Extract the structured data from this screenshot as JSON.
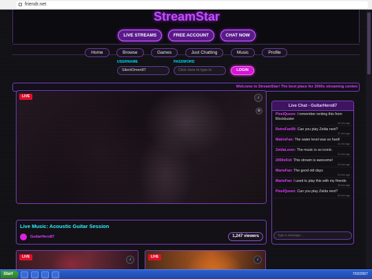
{
  "browser": {
    "url": "friendr.net"
  },
  "site": {
    "logo": "StreamStar",
    "top_buttons": [
      "LIVE STREAMS",
      "FREE ACCOUNT",
      "CHAT NOW"
    ],
    "menu": [
      "Home",
      "Browse",
      "Games",
      "Just Chatting",
      "Music",
      "Profile"
    ]
  },
  "login": {
    "username_label": "USERNAME",
    "username_value": "SilentOmen87",
    "password_label": "PASSWORD",
    "password_placeholder": "Click here to type in",
    "login_button": "LOGIN"
  },
  "ticker": "Welcome to StreamStar! The best place for 2000s streaming conten",
  "player": {
    "badge": "LIVE",
    "mute_icon": "speaker-icon",
    "settings_icon": "gear-icon"
  },
  "stream_info": {
    "title": "Live Music: Acoustic Guitar Session",
    "streamer": "GuitarHero87",
    "viewers": "1,247 viewers"
  },
  "thumbnails": [
    {
      "badge": "LIVE"
    },
    {
      "badge": "LIVE"
    }
  ],
  "chat": {
    "header": "Live Chat - GuitarHero87",
    "messages": [
      {
        "user": "PixelQueen:",
        "text": "I remember renting this from Blockbuster",
        "time": "30 min ago",
        "color": "#e040ff"
      },
      {
        "user": "RetroFan99:",
        "text": "Can you play Zelda next?",
        "time": "27 min ago",
        "color": "#e040ff"
      },
      {
        "user": "MatrixFan:",
        "text": "The water level was so hard!",
        "time": "41 min ago",
        "color": "#e040ff"
      },
      {
        "user": "ZeldaLover:",
        "text": "The music is so iconic.",
        "time": "31 min ago",
        "color": "#e040ff"
      },
      {
        "user": "2000sKid:",
        "text": "This stream is awesome!",
        "time": "24 min ago",
        "color": "#e040ff"
      },
      {
        "user": "MarioFan:",
        "text": "The good old days",
        "time": "23 min ago",
        "color": "#e040ff"
      },
      {
        "user": "MarioFan:",
        "text": "I used to play this with my friends",
        "time": "45 min ago",
        "color": "#e040ff"
      },
      {
        "user": "PixelQueen:",
        "text": "Can you play Zelda next?",
        "time": "53 min ago",
        "color": "#e040ff"
      }
    ],
    "input_placeholder": "Type a message..."
  },
  "taskbar": {
    "start": "Start",
    "clock": "7/02/2007"
  }
}
